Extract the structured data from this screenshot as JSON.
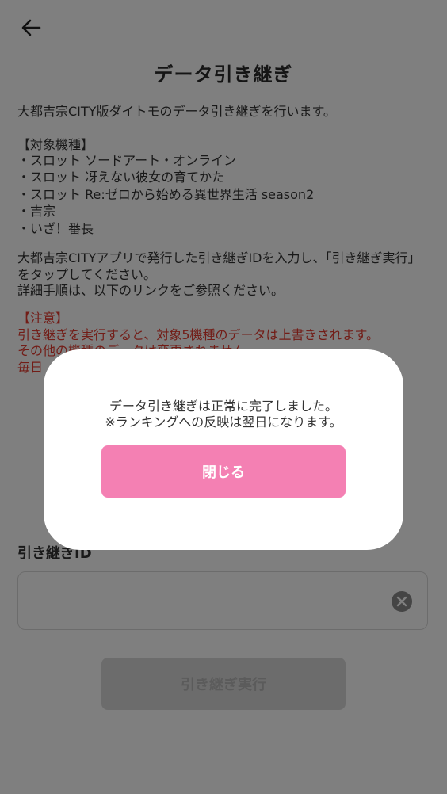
{
  "header": {
    "back_icon": "arrow-left-icon",
    "title": "データ引き継ぎ"
  },
  "content": {
    "intro": "大都吉宗CITY版ダイトモのデータ引き継ぎを行います。",
    "models_heading": "【対象機種】",
    "models": [
      "スロット ソードアート・オンライン",
      "スロット 冴えない彼女の育てかた",
      "スロット Re:ゼロから始める異世界生活 season2",
      "吉宗",
      "いざ！番長"
    ],
    "instructions": "大都吉宗CITYアプリで発行した引き継ぎIDを入力し、「引き継ぎ実行」をタップしてください。\n詳細手順は、以下のリンクをご参照ください。",
    "caution_heading": "【注意】",
    "caution_lines": [
      "引き継ぎを実行すると、対象5機種のデータは上書きされます。",
      "その他の機種のデータは変更されません。",
      "毎日"
    ]
  },
  "form": {
    "id_label": "引き継ぎID",
    "id_value": "",
    "clear_icon": "clear-circle-icon",
    "execute_label": "引き継ぎ実行"
  },
  "dialog": {
    "message": "データ引き継ぎは正常に完了しました。\n※ランキングへの反映は翌日になります。",
    "close_label": "閉じる"
  },
  "colors": {
    "accent_pink": "#f480b3",
    "caution_red": "#e53a2f",
    "overlay": "rgba(0,0,0,0.5)"
  }
}
